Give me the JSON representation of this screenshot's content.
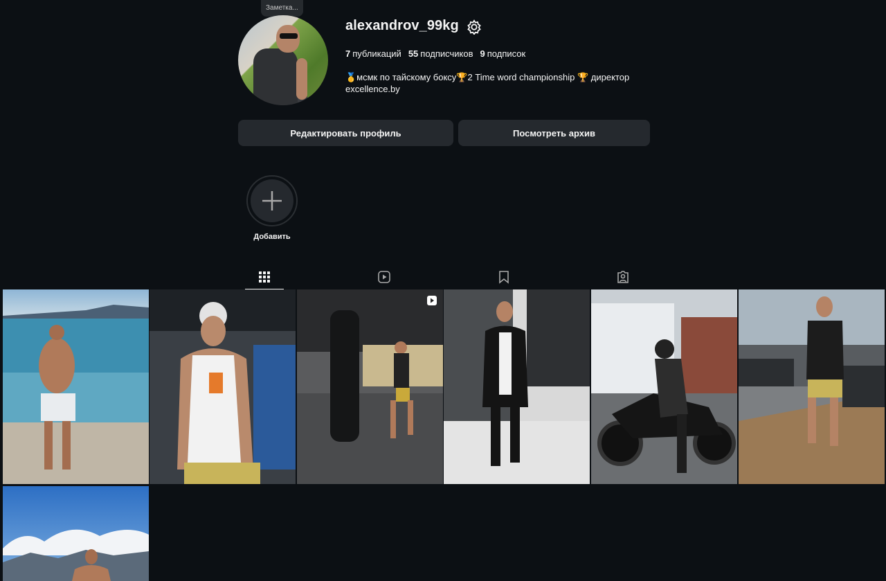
{
  "note": {
    "text": "Заметка..."
  },
  "profile": {
    "username": "alexandrov_99kg",
    "posts_count": "7",
    "posts_label": "публикаций",
    "followers_count": "55",
    "followers_label": "подписчиков",
    "following_count": "9",
    "following_label": "подписок",
    "bio_line1": "🥇мсмк по тайскому боксу🏆2 Time word championship 🏆 директор",
    "bio_line2": "excellence.by"
  },
  "buttons": {
    "edit_profile": "Редактировать профиль",
    "view_archive": "Посмотреть архив"
  },
  "highlights": {
    "add_label": "Добавить"
  },
  "tabs": [
    {
      "name": "posts",
      "icon": "grid-icon",
      "active": true
    },
    {
      "name": "reels",
      "icon": "reels-icon",
      "active": false
    },
    {
      "name": "saved",
      "icon": "bookmark-icon",
      "active": false
    },
    {
      "name": "tagged",
      "icon": "tagged-icon",
      "active": false
    }
  ],
  "posts": [
    {
      "id": "post-1",
      "scene": "beach",
      "reel": false
    },
    {
      "id": "post-2",
      "scene": "gym-selfie",
      "reel": false
    },
    {
      "id": "post-3",
      "scene": "boxing-gym",
      "reel": true
    },
    {
      "id": "post-4",
      "scene": "mirror-selfie",
      "reel": false
    },
    {
      "id": "post-5",
      "scene": "motorcycle",
      "reel": false
    },
    {
      "id": "post-6",
      "scene": "gym-hall",
      "reel": false
    },
    {
      "id": "post-7",
      "scene": "mountains",
      "reel": false
    }
  ],
  "colors": {
    "background": "#0c1014",
    "button_bg": "#25292e",
    "text": "#f5f5f5"
  }
}
